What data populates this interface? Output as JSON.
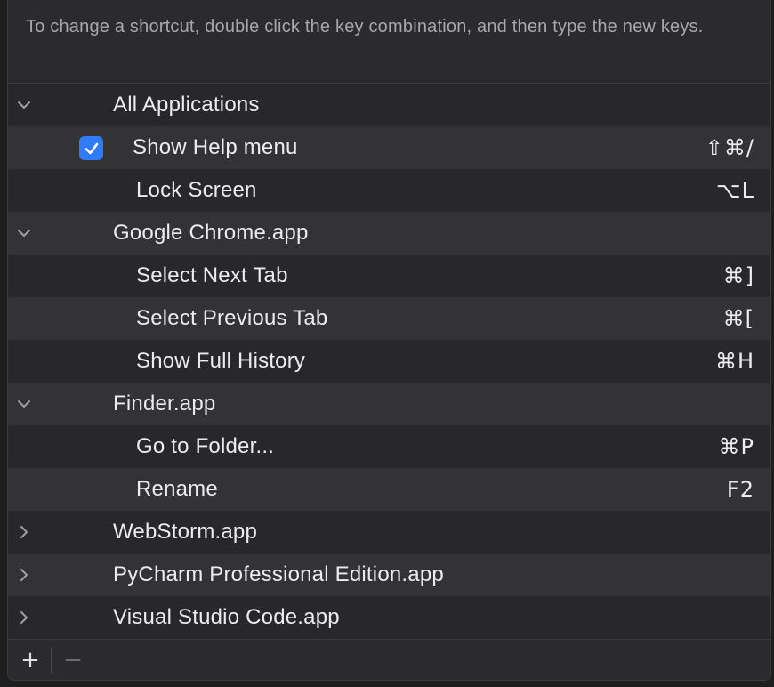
{
  "instructions": "To change a shortcut, double click the key combination, and then type the new keys.",
  "rows": [
    {
      "type": "group",
      "label": "All Applications",
      "expanded": true
    },
    {
      "type": "item",
      "label": "Show Help menu",
      "shortcut": "⇧⌘/",
      "checked": true
    },
    {
      "type": "item",
      "label": "Lock Screen",
      "shortcut": "⌥L"
    },
    {
      "type": "group",
      "label": "Google Chrome.app",
      "expanded": true
    },
    {
      "type": "item",
      "label": "Select Next Tab",
      "shortcut": "⌘]"
    },
    {
      "type": "item",
      "label": "Select Previous Tab",
      "shortcut": "⌘["
    },
    {
      "type": "item",
      "label": "Show Full History",
      "shortcut": "⌘H"
    },
    {
      "type": "group",
      "label": "Finder.app",
      "expanded": true
    },
    {
      "type": "item",
      "label": "Go to Folder...",
      "shortcut": "⌘P"
    },
    {
      "type": "item",
      "label": "Rename",
      "shortcut": "F2"
    },
    {
      "type": "group",
      "label": "WebStorm.app",
      "expanded": false
    },
    {
      "type": "group",
      "label": "PyCharm Professional Edition.app",
      "expanded": false
    },
    {
      "type": "group",
      "label": "Visual Studio Code.app",
      "expanded": false
    }
  ],
  "footer": {
    "add_label": "+",
    "remove_label": "−"
  },
  "colors": {
    "accent": "#2f7cf6",
    "background": "#2b2b2e"
  }
}
